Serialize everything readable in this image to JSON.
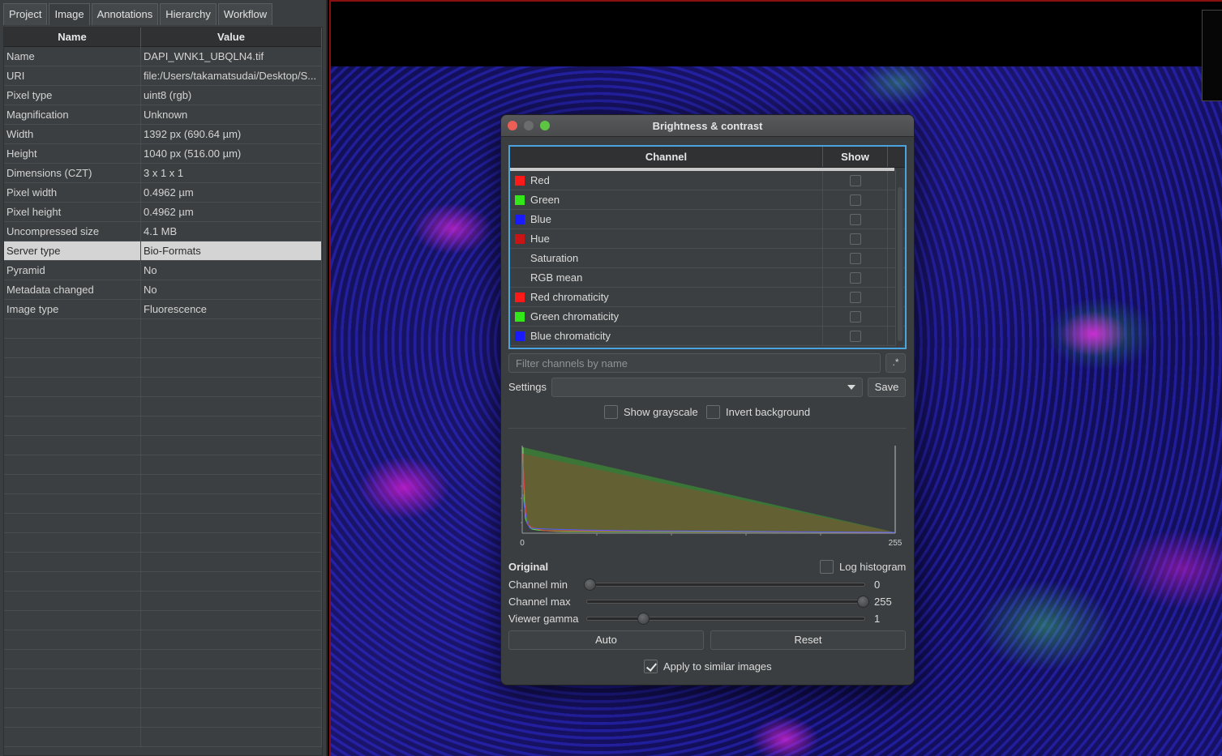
{
  "tabs": [
    "Project",
    "Image",
    "Annotations",
    "Hierarchy",
    "Workflow"
  ],
  "props": {
    "header_name": "Name",
    "header_value": "Value",
    "rows": [
      {
        "name": "Name",
        "value": "DAPI_WNK1_UBQLN4.tif"
      },
      {
        "name": "URI",
        "value": "file:/Users/takamatsudai/Desktop/S..."
      },
      {
        "name": "Pixel type",
        "value": "uint8 (rgb)"
      },
      {
        "name": "Magnification",
        "value": "Unknown"
      },
      {
        "name": "Width",
        "value": "1392 px (690.64 µm)"
      },
      {
        "name": "Height",
        "value": "1040 px (516.00 µm)"
      },
      {
        "name": "Dimensions (CZT)",
        "value": "3 x 1 x 1"
      },
      {
        "name": "Pixel width",
        "value": "0.4962 µm"
      },
      {
        "name": "Pixel height",
        "value": "0.4962 µm"
      },
      {
        "name": "Uncompressed size",
        "value": "4.1 MB"
      },
      {
        "name": "Server type",
        "value": "Bio-Formats",
        "selected": true
      },
      {
        "name": "Pyramid",
        "value": "No"
      },
      {
        "name": "Metadata changed",
        "value": "No"
      },
      {
        "name": "Image type",
        "value": "Fluorescence"
      }
    ]
  },
  "dialog": {
    "title": "Brightness & contrast",
    "channel_header": "Channel",
    "show_header": "Show",
    "channels": [
      {
        "name": "Red",
        "color": "#ff1a1a"
      },
      {
        "name": "Green",
        "color": "#33e61a"
      },
      {
        "name": "Blue",
        "color": "#1a1aff"
      },
      {
        "name": "Hue",
        "color": "#c81414"
      },
      {
        "name": "Saturation",
        "color": ""
      },
      {
        "name": "RGB mean",
        "color": ""
      },
      {
        "name": "Red chromaticity",
        "color": "#ff1a1a"
      },
      {
        "name": "Green chromaticity",
        "color": "#33e61a"
      },
      {
        "name": "Blue chromaticity",
        "color": "#1a1aff"
      }
    ],
    "filter_placeholder": "Filter channels by name",
    "regex_label": ".*",
    "settings_label": "Settings",
    "settings_value": "",
    "save_label": "Save",
    "show_grayscale": "Show grayscale",
    "invert_background": "Invert background",
    "histogram": {
      "x_min_label": "0",
      "x_max_label": "255",
      "range": [
        0,
        255
      ]
    },
    "original_label": "Original",
    "log_histogram": "Log histogram",
    "sliders": [
      {
        "label": "Channel min",
        "value": "0",
        "position": 0
      },
      {
        "label": "Channel max",
        "value": "255",
        "position": 255
      },
      {
        "label": "Viewer gamma",
        "value": "1",
        "position": 1
      }
    ],
    "auto_label": "Auto",
    "reset_label": "Reset",
    "apply_similar": "Apply to similar images",
    "apply_similar_checked": true
  }
}
